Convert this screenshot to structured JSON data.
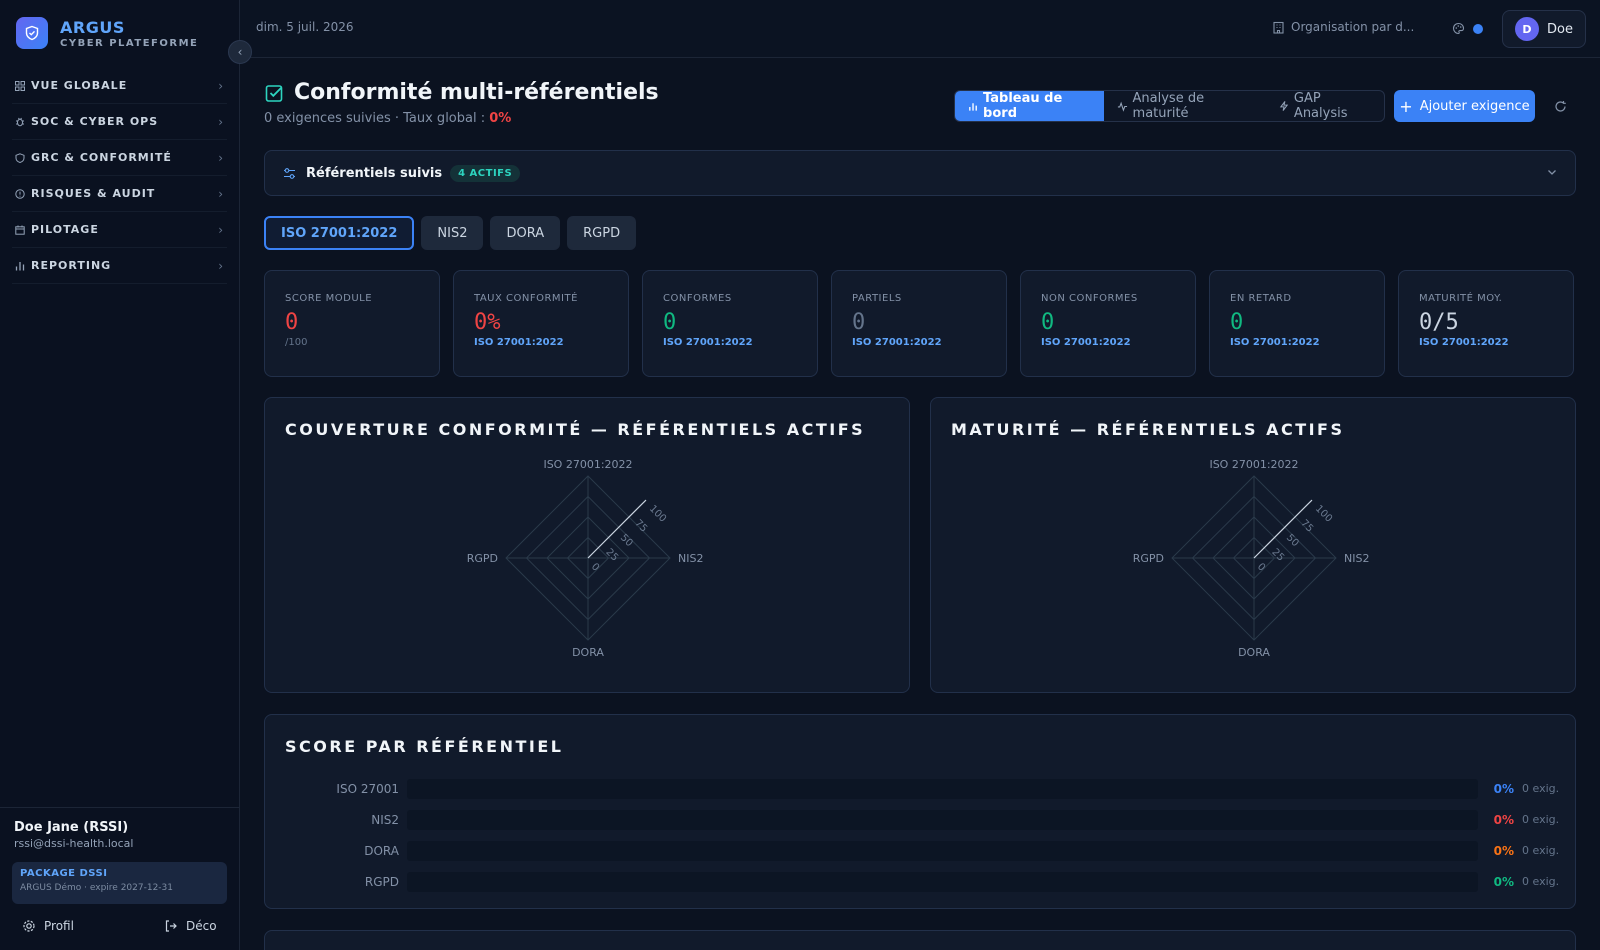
{
  "brand": {
    "name": "ARGUS",
    "subtitle": "CYBER PLATEFORME"
  },
  "sidebar": {
    "items": [
      {
        "label": "VUE GLOBALE",
        "icon": "grid-icon"
      },
      {
        "label": "SOC & CYBER OPS",
        "icon": "bug-icon"
      },
      {
        "label": "GRC & CONFORMITÉ",
        "icon": "shield-icon"
      },
      {
        "label": "RISQUES & AUDIT",
        "icon": "alert-icon"
      },
      {
        "label": "PILOTAGE",
        "icon": "calendar-icon"
      },
      {
        "label": "REPORTING",
        "icon": "bar-chart-icon"
      }
    ],
    "collapse_label": "‹",
    "user": {
      "name": "Doe Jane (RSSI)",
      "email": "rssi@dssi-health.local"
    },
    "package": {
      "title": "PACKAGE DSSI",
      "subtitle": "ARGUS Démo · expire 2027-12-31"
    },
    "profile_label": "Profil",
    "logout_label": "Déco"
  },
  "topbar": {
    "date": "dim. 5 juil. 2026",
    "organization": "Organisation par d...",
    "user_initial": "D",
    "user_name": "Doe"
  },
  "page": {
    "title": "Conformité multi-référentiels",
    "subtitle_prefix": "0 exigences suivies · Taux global : ",
    "global_rate": "0%",
    "view_tabs": [
      {
        "label": "Tableau de bord",
        "active": true
      },
      {
        "label": "Analyse de maturité",
        "active": false
      },
      {
        "label": "GAP Analysis",
        "active": false
      }
    ],
    "add_label": "Ajouter exigence"
  },
  "refs_panel": {
    "label": "Référentiels suivis",
    "badge": "4 ACTIFS"
  },
  "chips": [
    {
      "label": "ISO 27001:2022",
      "active": true
    },
    {
      "label": "NIS2",
      "active": false
    },
    {
      "label": "DORA",
      "active": false
    },
    {
      "label": "RGPD",
      "active": false
    }
  ],
  "kpis": [
    {
      "label": "SCORE MODULE",
      "value": "0",
      "foot": "/100",
      "color": "#ef4444",
      "foot_muted": true
    },
    {
      "label": "TAUX CONFORMITÉ",
      "value": "0%",
      "foot": "ISO 27001:2022",
      "color": "#ef4444",
      "foot_muted": false
    },
    {
      "label": "CONFORMES",
      "value": "0",
      "foot": "ISO 27001:2022",
      "color": "#10b981",
      "foot_muted": false
    },
    {
      "label": "PARTIELS",
      "value": "0",
      "foot": "ISO 27001:2022",
      "color": "#64748b",
      "foot_muted": false
    },
    {
      "label": "NON CONFORMES",
      "value": "0",
      "foot": "ISO 27001:2022",
      "color": "#10b981",
      "foot_muted": false
    },
    {
      "label": "EN RETARD",
      "value": "0",
      "foot": "ISO 27001:2022",
      "color": "#10b981",
      "foot_muted": false
    },
    {
      "label": "MATURITÉ MOY.",
      "value": "0/5",
      "foot": "ISO 27001:2022",
      "color": "#cbd5e1",
      "foot_muted": false
    }
  ],
  "chart_data": [
    {
      "type": "radar",
      "title": "COUVERTURE CONFORMITÉ — RÉFÉRENTIELS ACTIFS",
      "axes": [
        "ISO 27001:2022",
        "NIS2",
        "DORA",
        "RGPD"
      ],
      "ticks": [
        "0",
        "25",
        "50",
        "75",
        "100"
      ],
      "range": [
        0,
        100
      ],
      "values": [
        0,
        0,
        0,
        0
      ]
    },
    {
      "type": "radar",
      "title": "MATURITÉ — RÉFÉRENTIELS ACTIFS",
      "axes": [
        "ISO 27001:2022",
        "NIS2",
        "DORA",
        "RGPD"
      ],
      "ticks": [
        "0",
        "25",
        "50",
        "75",
        "100"
      ],
      "range": [
        0,
        100
      ],
      "values": [
        0,
        0,
        0,
        0
      ]
    },
    {
      "type": "bar",
      "orientation": "horizontal",
      "title": "SCORE PAR RÉFÉRENTIEL",
      "categories": [
        "ISO 27001",
        "NIS2",
        "DORA",
        "RGPD"
      ],
      "values": [
        0,
        0,
        0,
        0
      ],
      "labels": [
        "0%",
        "0%",
        "0%",
        "0%"
      ],
      "counts": [
        "0 exig.",
        "0 exig.",
        "0 exig.",
        "0 exig."
      ],
      "colors": [
        "#3b82f6",
        "#ef4444",
        "#f97316",
        "#10b981"
      ],
      "range": [
        0,
        100
      ]
    }
  ]
}
